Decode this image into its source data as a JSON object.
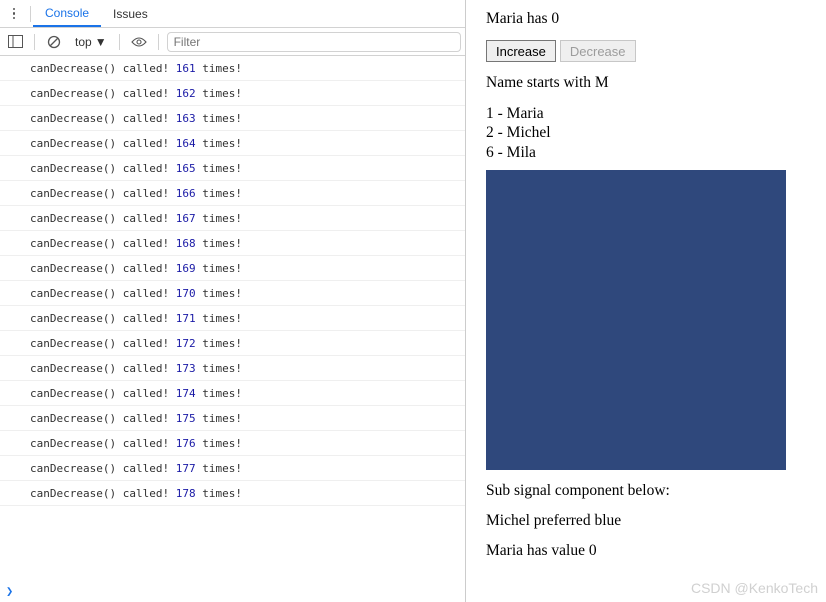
{
  "devtools": {
    "tabs": {
      "console": "Console",
      "issues": "Issues"
    },
    "context": "top",
    "filter_placeholder": "Filter",
    "prompt": "❯",
    "log_template": {
      "func": "canDecrease()",
      "mid": " called! ",
      "suffix": " times!"
    },
    "log_counts": [
      161,
      162,
      163,
      164,
      165,
      166,
      167,
      168,
      169,
      170,
      171,
      172,
      173,
      174,
      175,
      176,
      177,
      178
    ]
  },
  "app": {
    "header": "Maria has 0",
    "buttons": {
      "increase": "Increase",
      "decrease": "Decrease"
    },
    "filter_label": "Name starts with M",
    "names": [
      {
        "n": "1",
        "name": "Maria"
      },
      {
        "n": "2",
        "name": "Michel"
      },
      {
        "n": "6",
        "name": "Mila"
      }
    ],
    "sub_label": "Sub signal component below:",
    "pref_line": "Michel preferred blue",
    "value_line": "Maria has value 0"
  },
  "watermark": "CSDN @KenkoTech"
}
